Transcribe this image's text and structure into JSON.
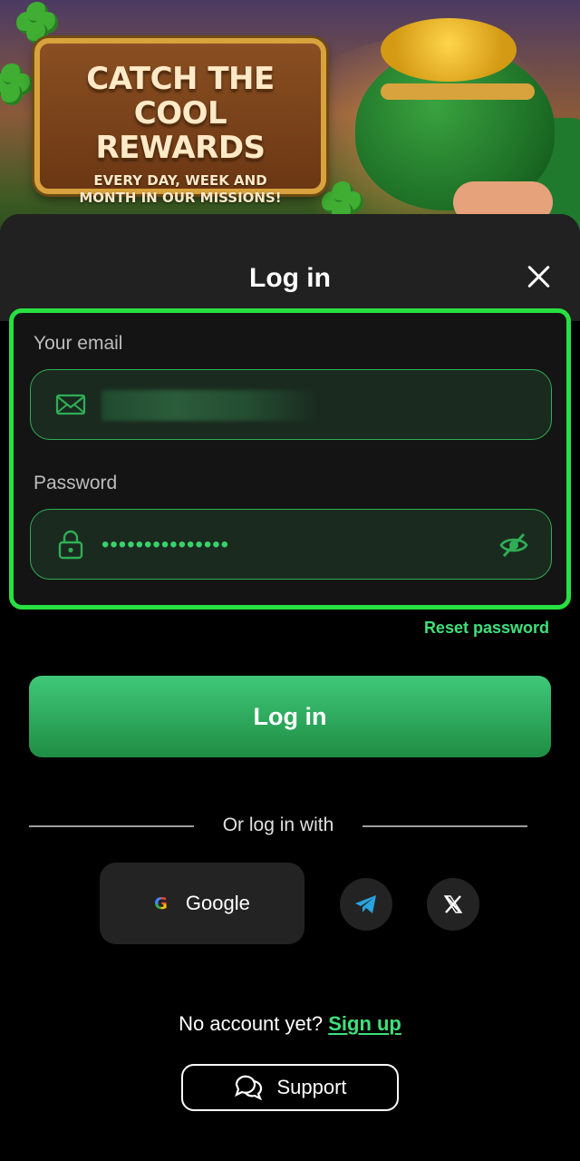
{
  "banner": {
    "headline_line1": "CATCH THE COOL",
    "headline_line2": "REWARDS",
    "subline_line1": "EVERY DAY, WEEK AND",
    "subline_line2": "MONTH IN OUR MISSIONS!"
  },
  "modal": {
    "title": "Log in"
  },
  "form": {
    "email_label": "Your email",
    "email_value": "",
    "password_label": "Password",
    "password_value": "•••••••••••••••",
    "reset_link": "Reset password",
    "submit_label": "Log in"
  },
  "social": {
    "divider_text": "Or log in with",
    "google_label": "Google"
  },
  "footer": {
    "no_account_text": "No account yet?",
    "signup_link": "Sign up",
    "support_label": "Support"
  },
  "colors": {
    "accent_green": "#3fe07a",
    "highlight_border": "#27e041",
    "button_gradient_top": "#3fc878",
    "button_gradient_bottom": "#1f8d44"
  },
  "icons": [
    "close-icon",
    "mail-icon",
    "lock-icon",
    "eye-off-icon",
    "google-icon",
    "telegram-icon",
    "x-icon",
    "chat-bubbles-icon"
  ]
}
